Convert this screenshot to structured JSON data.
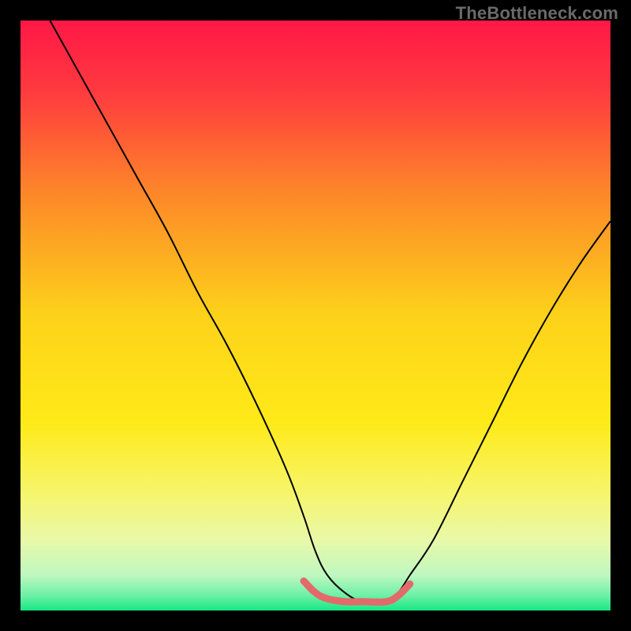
{
  "watermark": "TheBottleneck.com",
  "chart_data": {
    "type": "line",
    "title": "",
    "xlabel": "",
    "ylabel": "",
    "xlim": [
      0,
      100
    ],
    "ylim": [
      0,
      100
    ],
    "grid": false,
    "legend": false,
    "background": {
      "type": "vertical-gradient",
      "stops": [
        {
          "offset": 0.0,
          "color": "#ff1846"
        },
        {
          "offset": 0.12,
          "color": "#ff3a3f"
        },
        {
          "offset": 0.3,
          "color": "#fd8a28"
        },
        {
          "offset": 0.5,
          "color": "#fdd21a"
        },
        {
          "offset": 0.68,
          "color": "#feea18"
        },
        {
          "offset": 0.8,
          "color": "#f6f56a"
        },
        {
          "offset": 0.88,
          "color": "#e9f9a8"
        },
        {
          "offset": 0.94,
          "color": "#bff7c0"
        },
        {
          "offset": 0.975,
          "color": "#6cf0a6"
        },
        {
          "offset": 1.0,
          "color": "#17e884"
        }
      ]
    },
    "series": [
      {
        "name": "v-curve",
        "stroke": "#000000",
        "stroke_width": 2,
        "x": [
          5,
          10,
          15,
          20,
          25,
          30,
          35,
          40,
          45,
          48,
          50,
          52,
          55,
          58,
          62,
          64,
          66,
          70,
          75,
          80,
          85,
          90,
          95,
          100
        ],
        "y": [
          100,
          91,
          82,
          73,
          64,
          54,
          45,
          35,
          24,
          16,
          10,
          6,
          3,
          1.5,
          1.5,
          3,
          6,
          12,
          22,
          32,
          42,
          51,
          59,
          66
        ]
      },
      {
        "name": "highlight-bottom",
        "stroke": "#e36a6a",
        "stroke_width": 9,
        "linecap": "round",
        "x": [
          48,
          50,
          52,
          55,
          58,
          62,
          64,
          66
        ],
        "y": [
          5,
          3,
          2,
          1.5,
          1.5,
          1.5,
          2.5,
          4.5
        ]
      }
    ]
  }
}
